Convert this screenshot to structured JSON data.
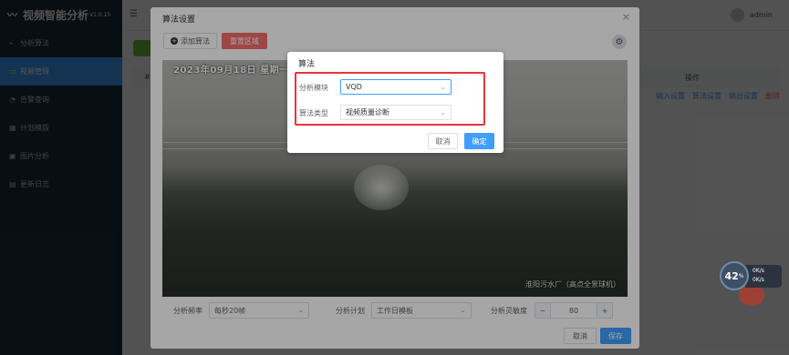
{
  "app": {
    "title": "视频智能分析",
    "version": "V1.0.15",
    "user": "admin"
  },
  "sidebar": {
    "items": [
      {
        "label": "分析算法",
        "icon": "pulse-icon",
        "active": false
      },
      {
        "label": "视频管理",
        "icon": "video-icon",
        "active": true
      },
      {
        "label": "告警查询",
        "icon": "alarm-icon",
        "active": false
      },
      {
        "label": "计划模版",
        "icon": "calendar-icon",
        "active": false
      },
      {
        "label": "图片分析",
        "icon": "image-icon",
        "active": false
      },
      {
        "label": "更新日志",
        "icon": "log-icon",
        "active": false
      }
    ]
  },
  "table": {
    "ops_header": "操作",
    "row_links": [
      "输入设置",
      "算法设置",
      "输出设置",
      "删除"
    ]
  },
  "dialog": {
    "title": "算法设置",
    "add_algo": "添加算法",
    "redraw": "重置区域",
    "video": {
      "timestamp": "2023年09月18日  星期一",
      "caption": "淮阳污水厂（高点全景球机）"
    },
    "freq_label": "分析频率",
    "freq_value": "每秒20帧",
    "plan_label": "分析计划",
    "plan_value": "工作日模板",
    "sens_label": "分析灵敏度",
    "sens_value": "80",
    "cancel": "取消",
    "save": "保存"
  },
  "algo_popup": {
    "title": "算法",
    "module_label": "分析模块",
    "module_value": "VQD",
    "type_label": "算法类型",
    "type_value": "视频质量诊断",
    "cancel": "取消",
    "ok": "确定"
  },
  "speed_widget": {
    "percent": "42",
    "up": "0K/s",
    "down": "0K/s"
  }
}
